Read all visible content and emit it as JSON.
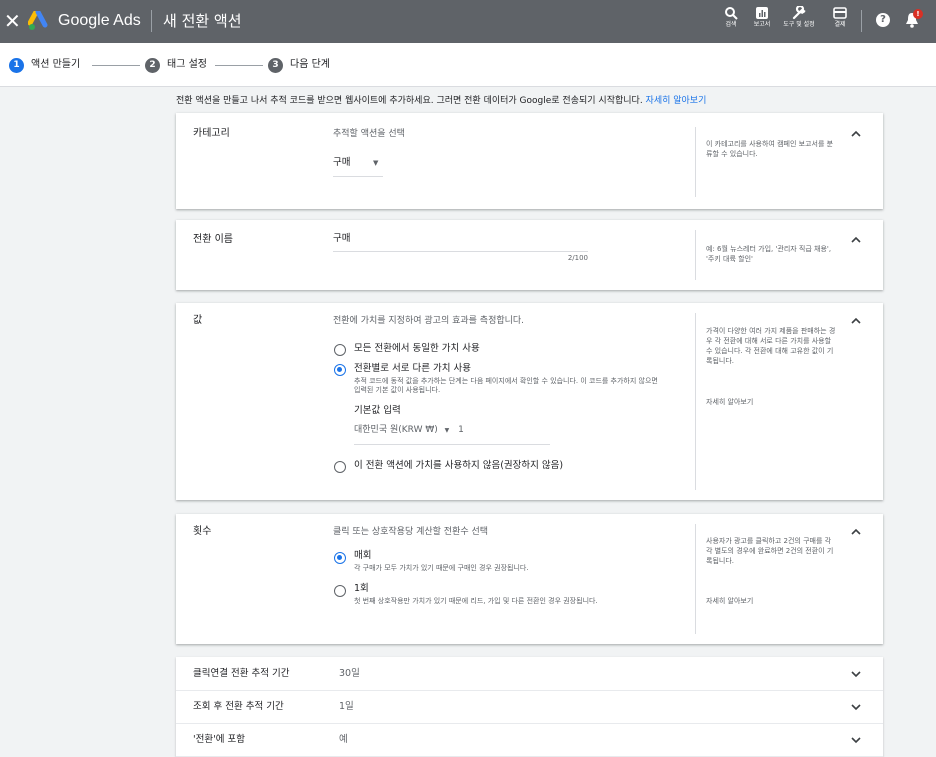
{
  "header": {
    "brand": "Google Ads",
    "title": "새 전환 액션",
    "tools": [
      {
        "label": "검색",
        "icon": "search-icon"
      },
      {
        "label": "보고서",
        "icon": "reports-icon"
      },
      {
        "label": "도구 및 설정",
        "icon": "wrench-icon"
      },
      {
        "label": "결제",
        "icon": "billing-icon"
      }
    ],
    "help": "?",
    "bell_badge": "!"
  },
  "stepper": {
    "steps": [
      {
        "num": "1",
        "label": "액션 만들기",
        "active": true
      },
      {
        "num": "2",
        "label": "태그 설정",
        "active": false
      },
      {
        "num": "3",
        "label": "다음 단계",
        "active": false
      }
    ]
  },
  "intro": {
    "text": "전환 액션을 만들고 나서 추적 코드를 받으면 웹사이트에 추가하세요. 그러면 전환 데이터가 Google로 전송되기 시작합니다. ",
    "link": "자세히 알아보기"
  },
  "category": {
    "title": "카테고리",
    "prompt": "추적할 액션을 선택",
    "selected": "구매",
    "help": "이 카테고리를 사용하여 캠페인 보고서를 분류할 수 있습니다."
  },
  "name": {
    "title": "전환 이름",
    "value": "구매",
    "counter": "2/100",
    "help": "예: 6월 뉴스레터 가입, '관리자 직급 채용', '주키 대륙 할인'"
  },
  "value": {
    "title": "값",
    "prompt": "전환에 가치를 지정하여 광고의 효과를 측정합니다.",
    "options": [
      {
        "label": "모든 전환에서 동일한 가치 사용",
        "selected": false
      },
      {
        "label": "전환별로 서로 다른 가치 사용",
        "selected": true,
        "desc": "추적 코드에 동적 값을 추가하는 단계는 다음 페이지에서 확인할 수 있습니다. 이 코드를 추가하지 않으면 입력된 기본 값이 사용됩니다."
      },
      {
        "label": "이 전환 액션에 가치를 사용하지 않음(권장하지 않음)",
        "selected": false
      }
    ],
    "default_label": "기본값 입력",
    "currency": "대한민국 원(KRW ₩)",
    "default_value": "1",
    "help": "가격이 다양한 여러 가지 제품을 판매하는 경우 각 전환에 대해 서로 다른 가치를 사용할 수 있습니다. 각 전환에 대해 고유한 값이 기록됩니다.",
    "help_link": "자세히 알아보기"
  },
  "count": {
    "title": "횟수",
    "prompt": "클릭 또는 상호작용당 계산할 전환수 선택",
    "options": [
      {
        "label": "매회",
        "selected": true,
        "desc": "각 구매가 모두 가치가 있기 때문에 구매인 경우 권장됩니다."
      },
      {
        "label": "1회",
        "selected": false,
        "desc": "첫 번째 상호작용만 가치가 있기 때문에 리드, 가입 및 다른 전환인 경우 권장됩니다."
      }
    ],
    "help": "사용자가 광고를 클릭하고 2건의 구매를 각각 별도의 경우에 완료하면 2건의 전환이 기록됩니다.",
    "help_link": "자세히 알아보기"
  },
  "rows": [
    {
      "label": "클릭연결 전환 추적 기간",
      "value": "30일"
    },
    {
      "label": "조회 후 전환 추적 기간",
      "value": "1일"
    },
    {
      "label": "'전환'에 포함",
      "value": "예"
    }
  ],
  "colors": {
    "accent": "#1a73e8",
    "header": "#5f6368",
    "step_inactive": "#5f6368"
  }
}
